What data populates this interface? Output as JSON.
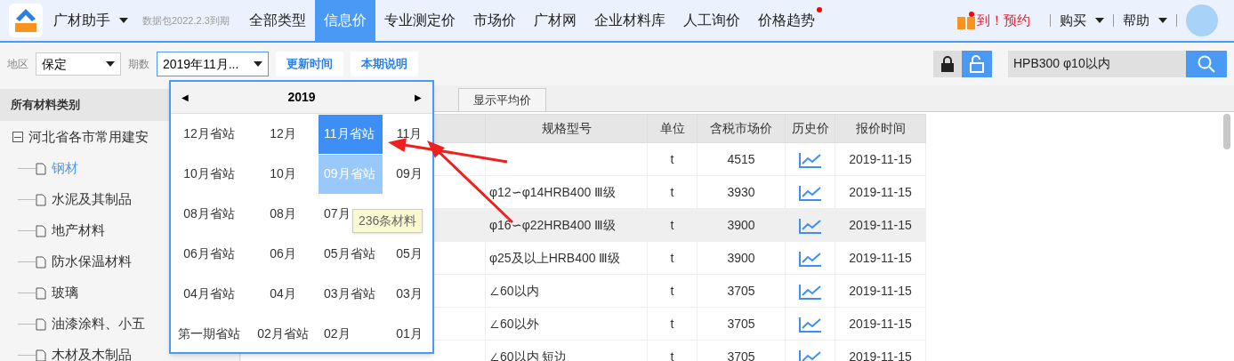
{
  "app": {
    "name": "广材助手",
    "expiry": "数据包2022.2.3到期"
  },
  "tabs": [
    {
      "label": "全部类型",
      "selected": false,
      "dot": false
    },
    {
      "label": "信息价",
      "selected": true,
      "dot": false
    },
    {
      "label": "专业测定价",
      "selected": false,
      "dot": false
    },
    {
      "label": "市场价",
      "selected": false,
      "dot": false
    },
    {
      "label": "广材网",
      "selected": false,
      "dot": false
    },
    {
      "label": "企业材料库",
      "selected": false,
      "dot": false
    },
    {
      "label": "人工询价",
      "selected": false,
      "dot": false
    },
    {
      "label": "价格趋势",
      "selected": false,
      "dot": true
    }
  ],
  "promo": "到！预约",
  "menus": [
    "购买",
    "帮助"
  ],
  "toolbar": {
    "region_label": "地区",
    "region": "保定",
    "period_label": "期数",
    "period": "2019年11月...",
    "buttons": [
      "更新时间",
      "本期说明"
    ],
    "lock": {
      "selected": false
    },
    "unlock": {
      "selected": true
    },
    "search": "HPB300 φ10以内"
  },
  "sidebar": {
    "title": "所有材料类别",
    "root": {
      "label": "河北省各市常用建安",
      "expanded": true,
      "children": [
        {
          "label": "钢材",
          "selected": true
        },
        {
          "label": "水泥及其制品",
          "selected": false
        },
        {
          "label": "地产材料",
          "selected": false
        },
        {
          "label": "防水保温材料",
          "selected": false
        },
        {
          "label": "玻璃",
          "selected": false
        },
        {
          "label": "油漆涂料、小五",
          "selected": false
        },
        {
          "label": "木材及木制品",
          "selected": false
        }
      ]
    }
  },
  "table": {
    "tab": "显示平均价",
    "columns": [
      "规格型号",
      "单位",
      "含税市场价",
      "历史价",
      "报价时间"
    ],
    "rows": [
      {
        "spec": "",
        "unit": "t",
        "price": "4515",
        "date": "2019-11-15",
        "selected": false
      },
      {
        "spec": "φ12∽φ14HRB400 Ⅲ级",
        "unit": "t",
        "price": "3930",
        "date": "2019-11-15",
        "selected": false
      },
      {
        "spec": "φ16∽φ22HRB400 Ⅲ级",
        "unit": "t",
        "price": "3900",
        "date": "2019-11-15",
        "selected": true
      },
      {
        "spec": "φ25及以上HRB400 Ⅲ级",
        "unit": "t",
        "price": "3900",
        "date": "2019-11-15",
        "selected": false
      },
      {
        "spec": "∠60以内",
        "unit": "t",
        "price": "3705",
        "date": "2019-11-15",
        "selected": false
      },
      {
        "spec": "∠60以外",
        "unit": "t",
        "price": "3705",
        "date": "2019-11-15",
        "selected": false
      },
      {
        "spec": "∠60以内 短边",
        "unit": "t",
        "price": "3705",
        "date": "2019-11-15",
        "selected": false
      }
    ]
  },
  "picker": {
    "prev": "◀",
    "year": "2019",
    "next": "▶",
    "rows": [
      [
        {
          "label": "12月省站",
          "selected": false,
          "hovered": false
        },
        {
          "label": "12月",
          "selected": false,
          "hovered": false
        },
        {
          "label": "11月省站",
          "selected": true,
          "hovered": false
        },
        {
          "label": "11月",
          "selected": false,
          "hovered": false
        }
      ],
      [
        {
          "label": "10月省站",
          "selected": false,
          "hovered": false
        },
        {
          "label": "10月",
          "selected": false,
          "hovered": false
        },
        {
          "label": "09月省站",
          "selected": false,
          "hovered": true
        },
        {
          "label": "09月",
          "selected": false,
          "hovered": false
        }
      ],
      [
        {
          "label": "08月省站",
          "selected": false,
          "hovered": false
        },
        {
          "label": "08月",
          "selected": false,
          "hovered": false
        },
        {
          "label": "07月",
          "selected": false,
          "hovered": false
        }
      ],
      [
        {
          "label": "06月省站",
          "selected": false,
          "hovered": false
        },
        {
          "label": "06月",
          "selected": false,
          "hovered": false
        },
        {
          "label": "05月省站",
          "selected": false,
          "hovered": false
        },
        {
          "label": "05月",
          "selected": false,
          "hovered": false
        }
      ],
      [
        {
          "label": "04月省站",
          "selected": false,
          "hovered": false
        },
        {
          "label": "04月",
          "selected": false,
          "hovered": false
        },
        {
          "label": "03月省站",
          "selected": false,
          "hovered": false
        },
        {
          "label": "03月",
          "selected": false,
          "hovered": false
        }
      ],
      [
        {
          "label": "第一期省站",
          "selected": false,
          "hovered": false
        },
        {
          "label": "02月省站",
          "selected": false,
          "hovered": false
        },
        {
          "label": "02月",
          "selected": false,
          "hovered": false
        },
        {
          "label": "01月",
          "selected": false,
          "hovered": false
        }
      ]
    ],
    "tooltip": "236条材料"
  }
}
